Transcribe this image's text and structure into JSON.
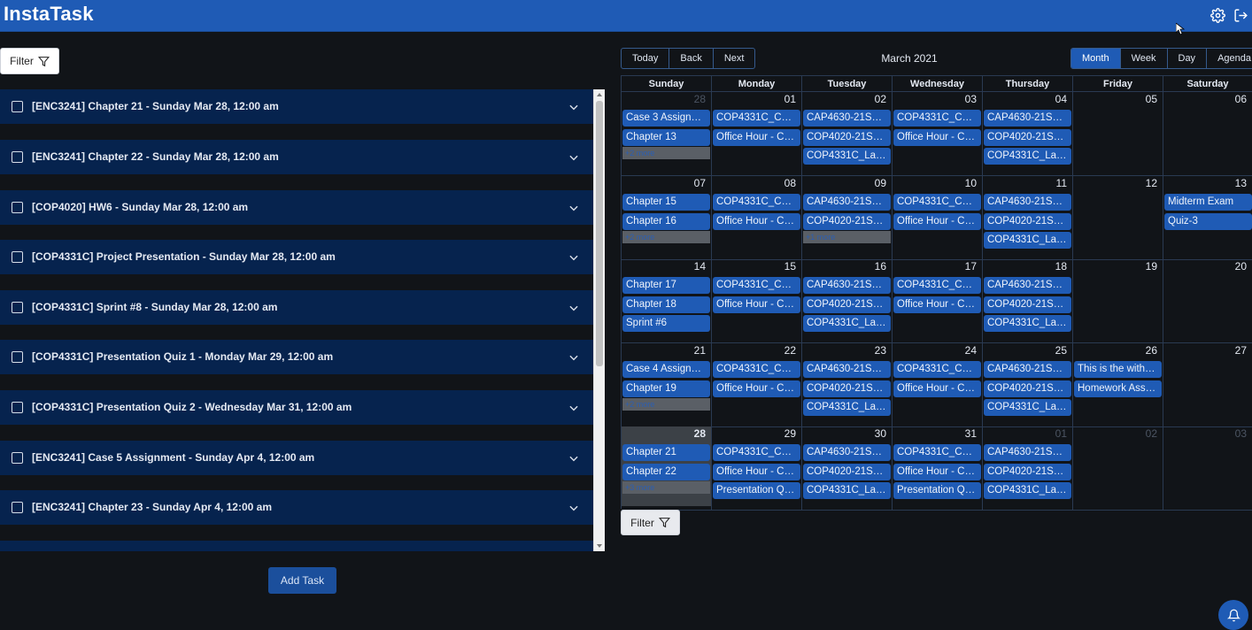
{
  "app": {
    "title": "InstaTask"
  },
  "topbar": {
    "icons": [
      "gear-icon",
      "logout-icon"
    ]
  },
  "task_panel": {
    "filter_label": "Filter",
    "tasks": [
      "[ENC3241] Chapter 21 - Sunday Mar 28, 12:00 am",
      "[ENC3241] Chapter 22 - Sunday Mar 28, 12:00 am",
      "[COP4020] HW6 - Sunday Mar 28, 12:00 am",
      "[COP4331C] Project Presentation - Sunday Mar 28, 12:00 am",
      "[COP4331C] Sprint #8 - Sunday Mar 28, 12:00 am",
      "[COP4331C] Presentation Quiz 1 - Monday Mar 29, 12:00 am",
      "[COP4331C] Presentation Quiz 2 - Wednesday Mar 31, 12:00 am",
      "[ENC3241] Case 5 Assignment - Sunday Apr 4, 12:00 am",
      "[ENC3241] Chapter 23 - Sunday Apr 4, 12:00 am"
    ],
    "add_task_label": "Add Task"
  },
  "calendar": {
    "nav": [
      "Today",
      "Back",
      "Next"
    ],
    "title": "March 2021",
    "views": [
      "Month",
      "Week",
      "Day",
      "Agenda"
    ],
    "active_view": "Month",
    "weekdays": [
      "Sunday",
      "Monday",
      "Tuesday",
      "Wednesday",
      "Thursday",
      "Friday",
      "Saturday"
    ],
    "weeks": [
      [
        {
          "day": "28",
          "off": true,
          "events": [
            "Case 3 Assign…",
            "Chapter 13"
          ],
          "more": "+2 more"
        },
        {
          "day": "01",
          "events": [
            "COP4331C_C…",
            "Office Hour - C…"
          ]
        },
        {
          "day": "02",
          "events": [
            "CAP4630-21S…",
            "COP4020-21S…",
            "COP4331C_La…"
          ]
        },
        {
          "day": "03",
          "events": [
            "COP4331C_C…",
            "Office Hour - C…"
          ]
        },
        {
          "day": "04",
          "events": [
            "CAP4630-21S…",
            "COP4020-21S…",
            "COP4331C_La…"
          ]
        },
        {
          "day": "05",
          "events": []
        },
        {
          "day": "06",
          "events": []
        }
      ],
      [
        {
          "day": "07",
          "events": [
            "Chapter 15",
            "Chapter 16"
          ],
          "more": "+2 more"
        },
        {
          "day": "08",
          "events": [
            "COP4331C_C…",
            "Office Hour - C…"
          ]
        },
        {
          "day": "09",
          "events": [
            "CAP4630-21S…",
            "COP4020-21S…"
          ],
          "more": "+1 more"
        },
        {
          "day": "10",
          "events": [
            "COP4331C_C…",
            "Office Hour - C…"
          ]
        },
        {
          "day": "11",
          "events": [
            "CAP4630-21S…",
            "COP4020-21S…",
            "COP4331C_La…"
          ]
        },
        {
          "day": "12",
          "events": []
        },
        {
          "day": "13",
          "events": [
            "Midterm Exam",
            "Quiz-3"
          ]
        }
      ],
      [
        {
          "day": "14",
          "events": [
            "Chapter 17",
            "Chapter 18",
            "Sprint #6"
          ]
        },
        {
          "day": "15",
          "events": [
            "COP4331C_C…",
            "Office Hour - C…"
          ]
        },
        {
          "day": "16",
          "events": [
            "CAP4630-21S…",
            "COP4020-21S…",
            "COP4331C_La…"
          ]
        },
        {
          "day": "17",
          "events": [
            "COP4331C_C…",
            "Office Hour - C…"
          ]
        },
        {
          "day": "18",
          "events": [
            "CAP4630-21S…",
            "COP4020-21S…",
            "COP4331C_La…"
          ]
        },
        {
          "day": "19",
          "events": []
        },
        {
          "day": "20",
          "events": []
        }
      ],
      [
        {
          "day": "21",
          "events": [
            "Case 4 Assign…",
            "Chapter 19"
          ],
          "more": "+2 more"
        },
        {
          "day": "22",
          "events": [
            "COP4331C_C…",
            "Office Hour - C…"
          ]
        },
        {
          "day": "23",
          "events": [
            "CAP4630-21S…",
            "COP4020-21S…",
            "COP4331C_La…"
          ]
        },
        {
          "day": "24",
          "events": [
            "COP4331C_C…",
            "Office Hour - C…"
          ]
        },
        {
          "day": "25",
          "events": [
            "CAP4630-21S…",
            "COP4020-21S…",
            "COP4331C_La…"
          ]
        },
        {
          "day": "26",
          "events": [
            "This is the with…",
            "Homework Ass…"
          ]
        },
        {
          "day": "27",
          "events": []
        }
      ],
      [
        {
          "day": "28",
          "today": true,
          "events": [
            "Chapter 21",
            "Chapter 22"
          ],
          "more": "+3 more"
        },
        {
          "day": "29",
          "events": [
            "COP4331C_C…",
            "Office Hour - C…",
            "Presentation Q…"
          ]
        },
        {
          "day": "30",
          "events": [
            "CAP4630-21S…",
            "COP4020-21S…",
            "COP4331C_La…"
          ]
        },
        {
          "day": "31",
          "events": [
            "COP4331C_C…",
            "Office Hour - C…",
            "Presentation Q…"
          ]
        },
        {
          "day": "01",
          "off": true,
          "events": [
            "CAP4630-21S…",
            "COP4020-21S…",
            "COP4331C_La…"
          ]
        },
        {
          "day": "02",
          "off": true,
          "events": []
        },
        {
          "day": "03",
          "off": true,
          "events": []
        }
      ]
    ],
    "filter_label": "Filter"
  },
  "colors": {
    "topbar": "#1f5bb5",
    "background": "#111418",
    "task_row": "#06234e",
    "event": "#1f5bb5"
  }
}
